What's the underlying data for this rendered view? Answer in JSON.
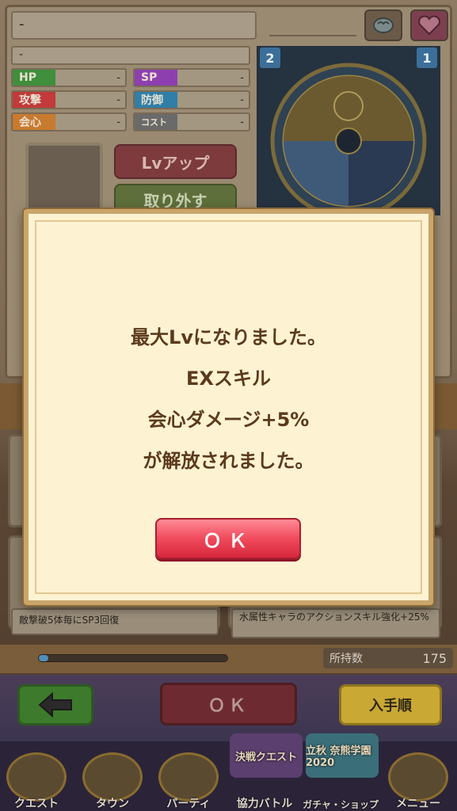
{
  "unit_panel": {
    "name": "-",
    "subtitle": "-",
    "stats": [
      {
        "label": "HP",
        "value": "-",
        "color": "#3f8f3c"
      },
      {
        "label": "SP",
        "value": "-",
        "color": "#8d3fb0"
      },
      {
        "label": "攻撃",
        "value": "-",
        "color": "#c23a3a"
      },
      {
        "label": "防御",
        "value": "-",
        "color": "#2f7fa8"
      },
      {
        "label": "会心",
        "value": "-",
        "color": "#c87a2e"
      },
      {
        "label": "コスト",
        "value": "-",
        "color": "#6a6a6a"
      }
    ],
    "lvup_label": "Lvアップ",
    "remove_label": "取り外す",
    "slot_numbers": [
      "2",
      "1"
    ]
  },
  "skill_cards": [
    {
      "text": "敵撃破5体毎にSP3回復"
    },
    {
      "text": "水属性キャラのアクションスキル強化+25%"
    }
  ],
  "progress": {
    "owned_label": "所持数",
    "owned_count": "175",
    "fill_fraction": 0.05
  },
  "action_bar": {
    "ok_label": "ＯＫ",
    "sort_label": "入手順"
  },
  "nav": [
    {
      "label": "クエスト"
    },
    {
      "label": "タウン"
    },
    {
      "label": "パーティ"
    },
    {
      "label": "協力バトル"
    },
    {
      "label": "ガチャ・ショップ"
    },
    {
      "label": "メニュー"
    }
  ],
  "banners": [
    {
      "text": "決戦クエスト"
    },
    {
      "text": "立秋 奈熊学園 2020"
    }
  ],
  "dialog": {
    "lines": [
      "最大Lvになりました。",
      "EXスキル",
      "会心ダメージ+5%",
      "が解放されました。"
    ],
    "ok_label": "ＯＫ"
  }
}
